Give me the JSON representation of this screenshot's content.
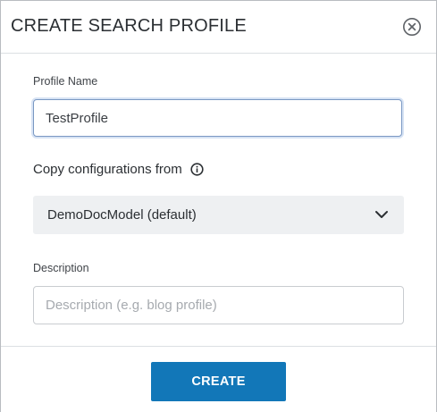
{
  "dialog": {
    "title": "CREATE SEARCH PROFILE",
    "close_icon": "circle-x-icon"
  },
  "form": {
    "profile_name": {
      "label": "Profile Name",
      "value": "TestProfile"
    },
    "copy_from": {
      "label": "Copy configurations from",
      "info_icon": "info-circle-icon",
      "selected": "DemoDocModel (default)",
      "chevron_icon": "chevron-down-icon"
    },
    "description": {
      "label": "Description",
      "value": "",
      "placeholder": "Description (e.g. blog profile)"
    }
  },
  "footer": {
    "create_label": "CREATE"
  },
  "colors": {
    "primary_button": "#1277b8",
    "focus_border": "#7a98c3",
    "select_bg": "#eef0f2",
    "text_dark": "#2b2f33"
  }
}
